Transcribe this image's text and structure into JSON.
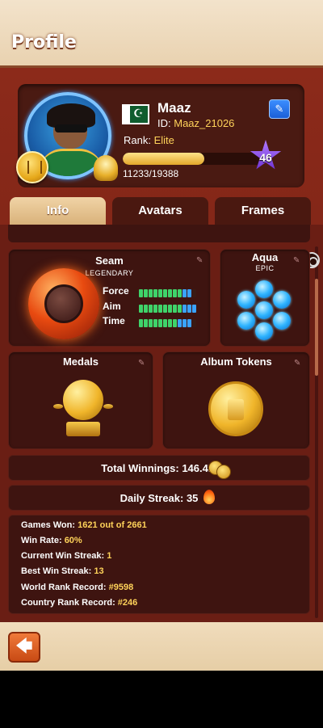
{
  "header": {
    "title": "Profile"
  },
  "profile": {
    "name": "Maaz",
    "id_label": "ID: ",
    "id_value": "Maaz_21026",
    "rank_label": "Rank: ",
    "rank_value": "Elite",
    "xp_text": "11233/19388",
    "xp_fraction": 0.579,
    "level": "46",
    "country_flag": "pakistan-flag-icon"
  },
  "tabs": [
    {
      "label": "Info",
      "active": true
    },
    {
      "label": "Avatars",
      "active": false
    },
    {
      "label": "Frames",
      "active": false
    }
  ],
  "seam": {
    "title": "Seam",
    "subtitle": "LEGENDARY",
    "stats": [
      {
        "label": "Force",
        "green": 9,
        "blue": 2,
        "total": 12
      },
      {
        "label": "Aim",
        "green": 9,
        "blue": 3,
        "total": 12
      },
      {
        "label": "Time",
        "green": 8,
        "blue": 3,
        "total": 12
      }
    ]
  },
  "aqua": {
    "title": "Aqua",
    "subtitle": "EPIC"
  },
  "medals": {
    "title": "Medals"
  },
  "album": {
    "title": "Album Tokens"
  },
  "total_winnings": {
    "label": "Total Winnings: ",
    "value": "146.4M"
  },
  "daily_streak": {
    "label": "Daily Streak: ",
    "value": "35"
  },
  "stats": [
    {
      "label": "Games Won: ",
      "value": "1621 out of 2661"
    },
    {
      "label": "Win Rate: ",
      "value": "60%"
    },
    {
      "label": "Current Win Streak: ",
      "value": "1"
    },
    {
      "label": "Best Win Streak: ",
      "value": "13"
    },
    {
      "label": "World Rank Record: ",
      "value": "#9598"
    },
    {
      "label": "Country Rank Record: ",
      "value": "#246"
    }
  ],
  "footer": {
    "back_icon": "back-arrow-icon"
  },
  "colors": {
    "accent_gold": "#ffd35a",
    "bg_red": "#7a2316",
    "panel": "#3e1410"
  }
}
